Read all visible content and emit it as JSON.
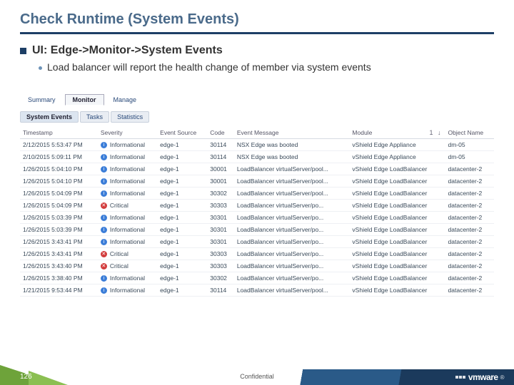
{
  "title": "Check Runtime (System Events)",
  "bullet1": "UI: Edge->Monitor->System Events",
  "bullet2": "Load balancer will report the health change of member via system events",
  "tabs": {
    "summary": "Summary",
    "monitor": "Monitor",
    "manage": "Manage"
  },
  "subtabs": {
    "events": "System Events",
    "tasks": "Tasks",
    "stats": "Statistics"
  },
  "cols": {
    "timestamp": "Timestamp",
    "severity": "Severity",
    "eventsrc": "Event Source",
    "code": "Code",
    "eventmsg": "Event Message",
    "module": "Module",
    "objname": "Object Name"
  },
  "sev": {
    "info": "Informational",
    "crit": "Critical"
  },
  "rows": [
    {
      "ts": "2/12/2015 5:53:47 PM",
      "sev": "info",
      "src": "edge-1",
      "code": "30114",
      "msg": "NSX Edge was booted",
      "mod": "vShield Edge Appliance",
      "obj": "dm-05"
    },
    {
      "ts": "2/10/2015 5:09:11 PM",
      "sev": "info",
      "src": "edge-1",
      "code": "30114",
      "msg": "NSX Edge was booted",
      "mod": "vShield Edge Appliance",
      "obj": "dm-05"
    },
    {
      "ts": "1/26/2015 5:04:10 PM",
      "sev": "info",
      "src": "edge-1",
      "code": "30001",
      "msg": "LoadBalancer virtualServer/pool...",
      "mod": "vShield Edge LoadBalancer",
      "obj": "datacenter-2"
    },
    {
      "ts": "1/26/2015 5:04:10 PM",
      "sev": "info",
      "src": "edge-1",
      "code": "30001",
      "msg": "LoadBalancer virtualServer/pool...",
      "mod": "vShield Edge LoadBalancer",
      "obj": "datacenter-2"
    },
    {
      "ts": "1/26/2015 5:04:09 PM",
      "sev": "info",
      "src": "edge-1",
      "code": "30302",
      "msg": "LoadBalancer virtualServer/pool...",
      "mod": "vShield Edge LoadBalancer",
      "obj": "datacenter-2"
    },
    {
      "ts": "1/26/2015 5:04:09 PM",
      "sev": "crit",
      "src": "edge-1",
      "code": "30303",
      "msg": "LoadBalancer virtualServer/po...",
      "mod": "vShield Edge LoadBalancer",
      "obj": "datacenter-2"
    },
    {
      "ts": "1/26/2015 5:03:39 PM",
      "sev": "info",
      "src": "edge-1",
      "code": "30301",
      "msg": "LoadBalancer virtualServer/po...",
      "mod": "vShield Edge LoadBalancer",
      "obj": "datacenter-2"
    },
    {
      "ts": "1/26/2015 5:03:39 PM",
      "sev": "info",
      "src": "edge-1",
      "code": "30301",
      "msg": "LoadBalancer virtualServer/po...",
      "mod": "vShield Edge LoadBalancer",
      "obj": "datacenter-2"
    },
    {
      "ts": "1/26/2015 3:43:41 PM",
      "sev": "info",
      "src": "edge-1",
      "code": "30301",
      "msg": "LoadBalancer virtualServer/po...",
      "mod": "vShield Edge LoadBalancer",
      "obj": "datacenter-2"
    },
    {
      "ts": "1/26/2015 3:43:41 PM",
      "sev": "crit",
      "src": "edge-1",
      "code": "30303",
      "msg": "LoadBalancer virtualServer/po...",
      "mod": "vShield Edge LoadBalancer",
      "obj": "datacenter-2"
    },
    {
      "ts": "1/26/2015 3:43:40 PM",
      "sev": "crit",
      "src": "edge-1",
      "code": "30303",
      "msg": "LoadBalancer virtualServer/po...",
      "mod": "vShield Edge LoadBalancer",
      "obj": "datacenter-2"
    },
    {
      "ts": "1/26/2015 3:38:40 PM",
      "sev": "info",
      "src": "edge-1",
      "code": "30302",
      "msg": "LoadBalancer virtualServer/po...",
      "mod": "vShield Edge LoadBalancer",
      "obj": "datacenter-2"
    },
    {
      "ts": "1/21/2015 9:53:44 PM",
      "sev": "info",
      "src": "edge-1",
      "code": "30114",
      "msg": "LoadBalancer virtualServer/pool...",
      "mod": "vShield Edge LoadBalancer",
      "obj": "datacenter-2"
    }
  ],
  "footer": {
    "page": "126",
    "conf": "Confidential",
    "brand": "vmware"
  }
}
